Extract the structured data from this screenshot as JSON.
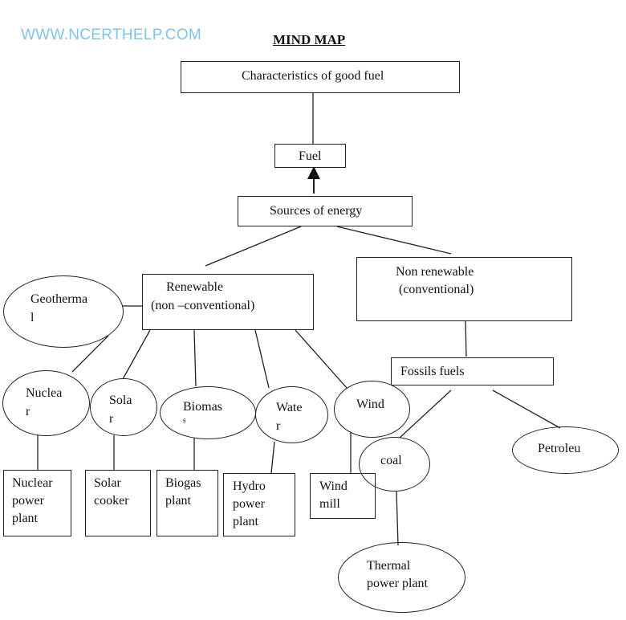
{
  "watermark": "WWW.NCERTHELP.COM",
  "title": "MIND MAP",
  "nodes": {
    "characteristics": "Characteristics of good fuel",
    "fuel": "Fuel",
    "sources": "Sources of energy",
    "renewable_line1": "Renewable",
    "renewable_line2": "(non –conventional)",
    "non_renewable_line1": "Non renewable",
    "non_renewable_line2": "(conventional)",
    "fossil_fuels": "Fossils fuels",
    "geothermal_line1": "Geotherma",
    "geothermal_line2": "l",
    "nuclear_line1": "Nuclea",
    "nuclear_line2": "r",
    "solar_line1": "Sola",
    "solar_line2": "r",
    "biomass_line1": "Biomas",
    "biomass_line2": "s",
    "water_line1": "Wate",
    "water_line2": "r",
    "wind": "Wind",
    "coal": "coal",
    "petroleum": "Petroleu",
    "nuclear_plant": [
      "Nuclear",
      "power",
      "plant"
    ],
    "solar_cooker": [
      "Solar",
      "cooker"
    ],
    "biogas_plant": [
      "Biogas",
      "plant"
    ],
    "hydro_plant": [
      "Hydro",
      "power",
      "plant"
    ],
    "wind_mill": [
      "Wind",
      "mill"
    ],
    "thermal_plant": [
      "Thermal",
      "power plant"
    ]
  }
}
